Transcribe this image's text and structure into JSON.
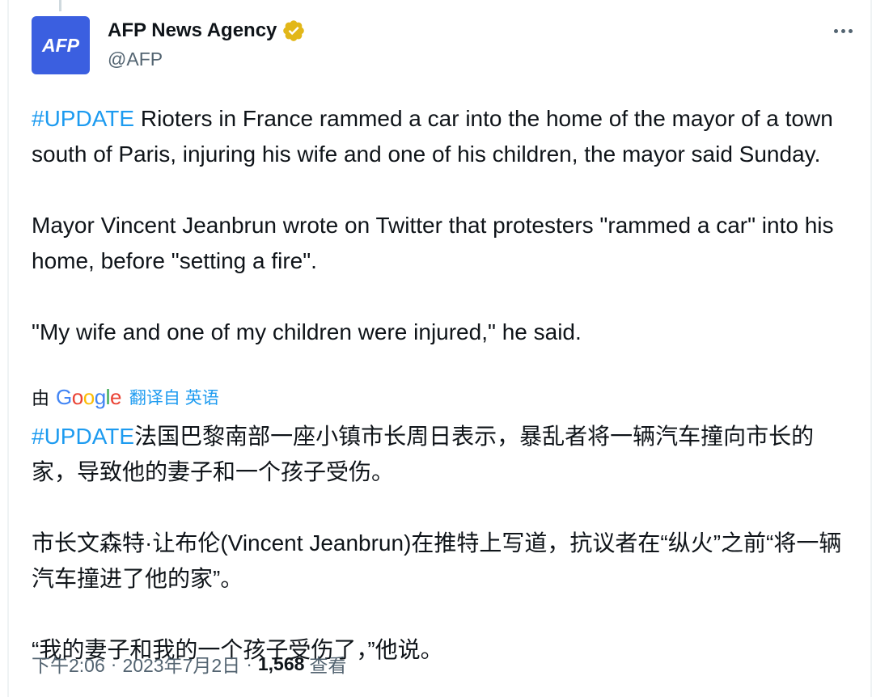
{
  "author": {
    "display_name": "AFP News Agency",
    "handle": "@AFP",
    "avatar_text": "AFP",
    "verified_icon": "verified-gold-badge-icon",
    "avatar_color": "#3b5fe0"
  },
  "more_icon": "more-horizontal-icon",
  "tweet": {
    "para1_hashtag": "#UPDATE",
    "para1_text": " Rioters in France rammed a car into the home of the mayor of a town south of Paris, injuring his wife and one of his children, the mayor said Sunday.",
    "para2": "Mayor Vincent Jeanbrun wrote on Twitter that protesters \"rammed a car\" into his home, before \"setting a fire\".",
    "para3": "\"My wife and one of my children were injured,\" he said."
  },
  "translation": {
    "by_label": "由",
    "google_letters": [
      "G",
      "o",
      "o",
      "g",
      "l",
      "e"
    ],
    "link_label": "翻译自 英语",
    "para1_hashtag": "#UPDATE",
    "para1_text": "法国巴黎南部一座小镇市长周日表示，暴乱者将一辆汽车撞向市长的家，导致他的妻子和一个孩子受伤。",
    "para2": "市长文森特·让布伦(Vincent Jeanbrun)在推特上写道，抗议者在“纵火”之前“将一辆汽车撞进了他的家”。",
    "para3": "“我的妻子和我的一个孩子受伤了，”他说。"
  },
  "meta": {
    "time": "下午2:06",
    "separator": "·",
    "date": "2023年7月2日",
    "views_count": "1,568",
    "views_label": "查看"
  },
  "colors": {
    "link_blue": "#1d9bf0",
    "secondary_text": "#536471",
    "primary_text": "#0f1419",
    "verified_gold": "#e2b719"
  }
}
